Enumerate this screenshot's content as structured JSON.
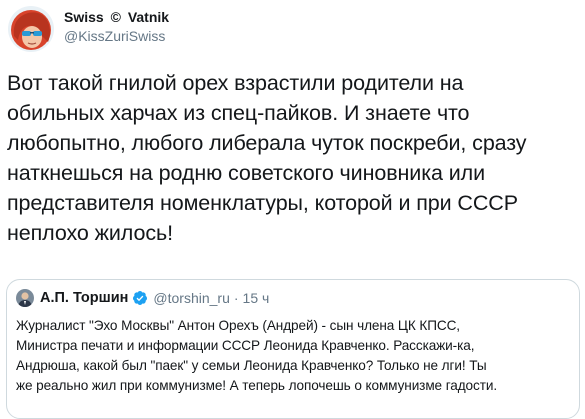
{
  "tweet": {
    "author": {
      "name_part1": "Swiss",
      "name_symbol": "©",
      "name_part2": "Vatnik",
      "handle": "@KissZuriSwiss",
      "avatar_icon": "cartoon-avatar-red-hair-sunglasses"
    },
    "text": "Вот такой гнилой орех взрастили родители на\nобильных харчах из спец-пайков. И знаете что\nлюбопытно, любого либерала чуток поскреби, сразу\nнаткнешься на родню советского чиновника или\nпредставителя номенклатуры, которой и при СССР\nнеплохо жилось!"
  },
  "quote": {
    "author": {
      "name": "А.П. Торшин",
      "verified_icon": "verified-badge-icon",
      "handle": "@torshin_ru",
      "separator": "·",
      "time": "15 ч",
      "avatar_icon": "portrait-avatar"
    },
    "text": "Журналист \"Эхо Москвы\" Антон Орехъ (Андрей) - сын члена ЦК КПСС,\nМинистра печати и информации СССР Леонида Кравченко. Расскажи-ка,\nАндрюша, какой был \"паек\" у семьи Леонида Кравченко? Только не лги! Ты\nже реально жил при коммунизме! А теперь лопочешь о коммунизме гадости."
  },
  "colors": {
    "text": "#14171a",
    "secondary": "#657786",
    "verified": "#1da1f2",
    "border": "#cfd9de"
  }
}
